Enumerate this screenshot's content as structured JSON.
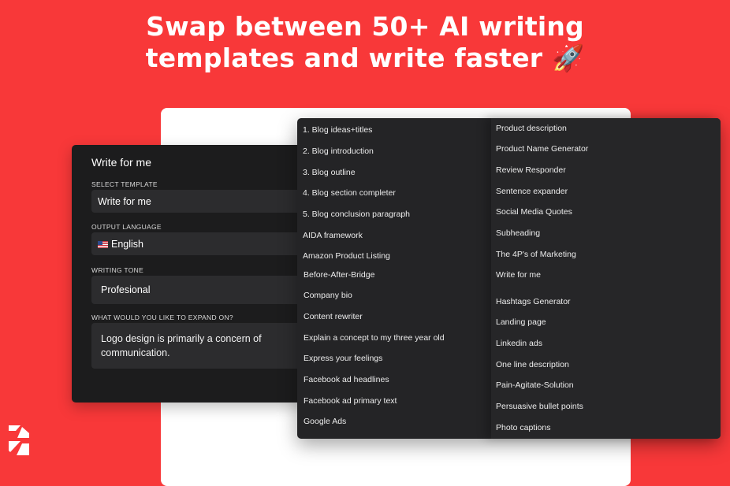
{
  "headline": {
    "line1": "Swap between 50+ AI writing",
    "line2": "templates and write faster 🚀"
  },
  "form": {
    "title": "Write for me",
    "template_label": "SELECT TEMPLATE",
    "template_value": "Write for me",
    "language_label": "OUTPUT LANGUAGE",
    "language_flag": "🇺🇸",
    "language_value": "English",
    "tone_label": "WRITING TONE",
    "tone_value": "Profesional",
    "expand_label": "WHAT WOULD YOU LIKE TO EXPAND ON?",
    "expand_value": "Logo design is primarily a concern of communication."
  },
  "menu": {
    "left": [
      "1. Blog ideas+titles",
      "2. Blog introduction",
      "3. Blog outline",
      "4. Blog section completer",
      "5. Blog conclusion paragraph",
      "AIDA framework",
      "Amazon Product Listing",
      "Before-After-Bridge",
      "Company bio",
      "Content rewriter",
      "Explain a concept to my three year old",
      "Express your feelings",
      "Facebook ad headlines",
      "Facebook ad primary text",
      "Google Ads"
    ],
    "right": [
      "Product description",
      "Product Name Generator",
      "Review Responder",
      "Sentence expander",
      "Social Media Quotes",
      "Subheading",
      "The 4P's of Marketing",
      "Write for me",
      "Hashtags Generator",
      "Landing page",
      "Linkedin ads",
      "One line description",
      "Pain-Agitate-Solution",
      "Persuasive bullet points",
      "Photo captions"
    ]
  },
  "colors": {
    "background": "#f83839",
    "panel": "#1c1c1d",
    "field": "#2c2c2e",
    "menu": "#242426",
    "text": "#ffffff"
  },
  "logo_icon": "brand-logo-icon"
}
